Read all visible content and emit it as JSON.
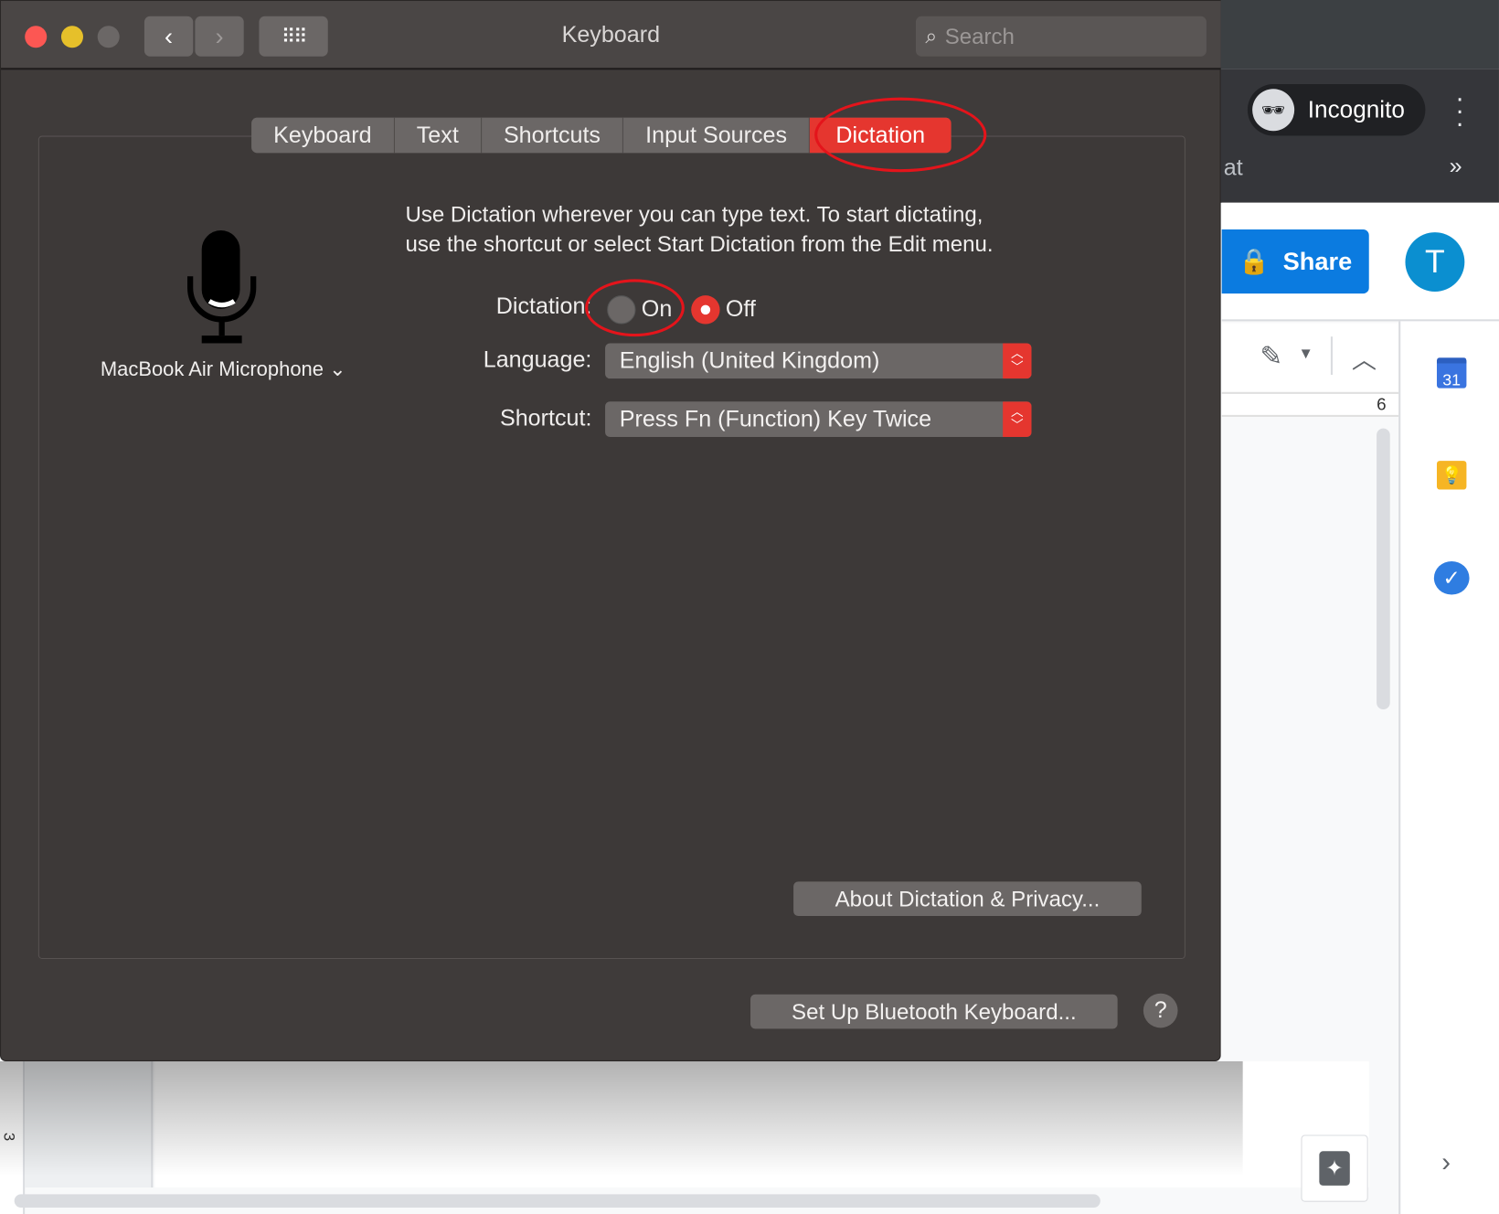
{
  "browser": {
    "incognito_label": "Incognito",
    "tab_fragment": "at",
    "more_tabs": "»",
    "share_label": "Share",
    "avatar_initial": "T",
    "ruler_number": "6",
    "left_ruler_number": "3",
    "calendar_day": "31",
    "colors": {
      "share": "#0b7be0",
      "avatar": "#0b8fd0"
    }
  },
  "dialog": {
    "title": "Keyboard",
    "search_placeholder": "Search",
    "tabs": [
      {
        "label": "Keyboard",
        "selected": false
      },
      {
        "label": "Text",
        "selected": false
      },
      {
        "label": "Shortcuts",
        "selected": false
      },
      {
        "label": "Input Sources",
        "selected": false
      },
      {
        "label": "Dictation",
        "selected": true
      }
    ],
    "microphone_selector": "MacBook Air Microphone",
    "description_line1": "Use Dictation wherever you can type text. To start dictating,",
    "description_line2": "use the shortcut or select Start Dictation from the Edit menu.",
    "dictation_label": "Dictation:",
    "dictation_options": [
      {
        "label": "On",
        "selected": false
      },
      {
        "label": "Off",
        "selected": true
      }
    ],
    "language_label": "Language:",
    "language_value": "English (United Kingdom)",
    "shortcut_label": "Shortcut:",
    "shortcut_value": "Press Fn (Function) Key Twice",
    "about_button": "About Dictation & Privacy...",
    "bluetooth_button": "Set Up Bluetooth Keyboard...",
    "help_button": "?",
    "accent_color": "#e5362f",
    "annotation_color": "#e4141b"
  }
}
